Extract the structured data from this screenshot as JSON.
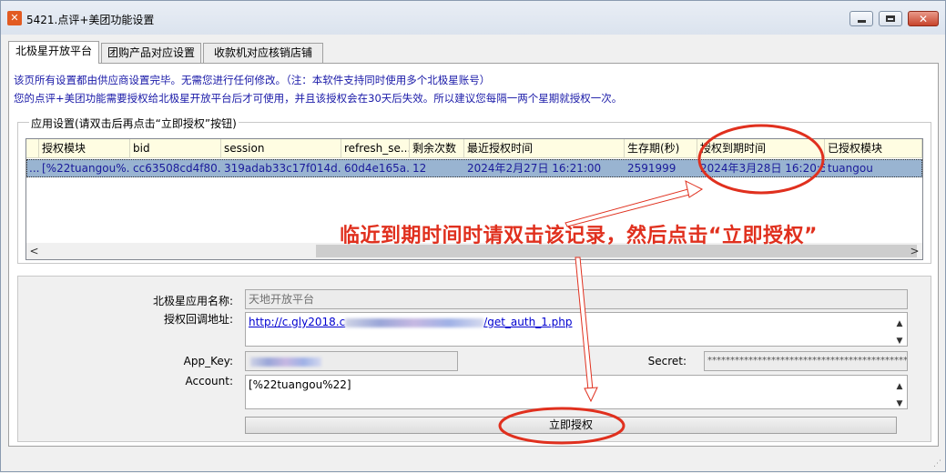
{
  "window": {
    "title": "5421.点评+美团功能设置"
  },
  "tabs": [
    {
      "label": "北极星开放平台",
      "active": true
    },
    {
      "label": "团购产品对应设置",
      "active": false
    },
    {
      "label": "收款机对应核销店铺",
      "active": false
    }
  ],
  "info": {
    "line1": "该页所有设置都由供应商设置完毕。无需您进行任何修改。（注：本软件支持同时使用多个北极星账号）",
    "line2": "您的点评+美团功能需要授权给北极星开放平台后才可使用，并且该授权会在30天后失效。所以建议您每隔一两个星期就授权一次。"
  },
  "group": {
    "legend": "应用设置(请双击后再点击“立即授权”按钮)"
  },
  "grid": {
    "columns": [
      "授权模块",
      "bid",
      "session",
      "refresh_se...",
      "剩余次数",
      "最近授权时间",
      "生存期(秒)",
      "授权到期时间",
      "已授权模块"
    ],
    "row": {
      "lead": "...",
      "cells": [
        "[%22tuangou%...",
        "cc63508cd4f80...",
        "319adab33c17f014d...",
        "60d4e165a...",
        "12",
        "2024年2月27日 16:21:00",
        "2591999",
        "2024年3月28日 16:20:59",
        "tuangou"
      ]
    },
    "scroll_left": "<",
    "scroll_right": ">"
  },
  "annotation": {
    "text": "临近到期时间时请双击该记录，然后点击“立即授权”",
    "color": "#e0301e"
  },
  "form": {
    "app_name_label": "北极星应用名称:",
    "app_name_value": "天地开放平台",
    "callback_label": "授权回调地址:",
    "callback_prefix": "http://c.gly2018.c",
    "callback_suffix": "/get_auth_1.php",
    "app_key_label": "App_Key:",
    "secret_label": "Secret:",
    "secret_value": "********************************************",
    "account_label": "Account:",
    "account_value": "[%22tuangou%22]",
    "authorize_button": "立即授权"
  },
  "icons": {
    "scroll_up": "▲",
    "scroll_down": "▼"
  }
}
